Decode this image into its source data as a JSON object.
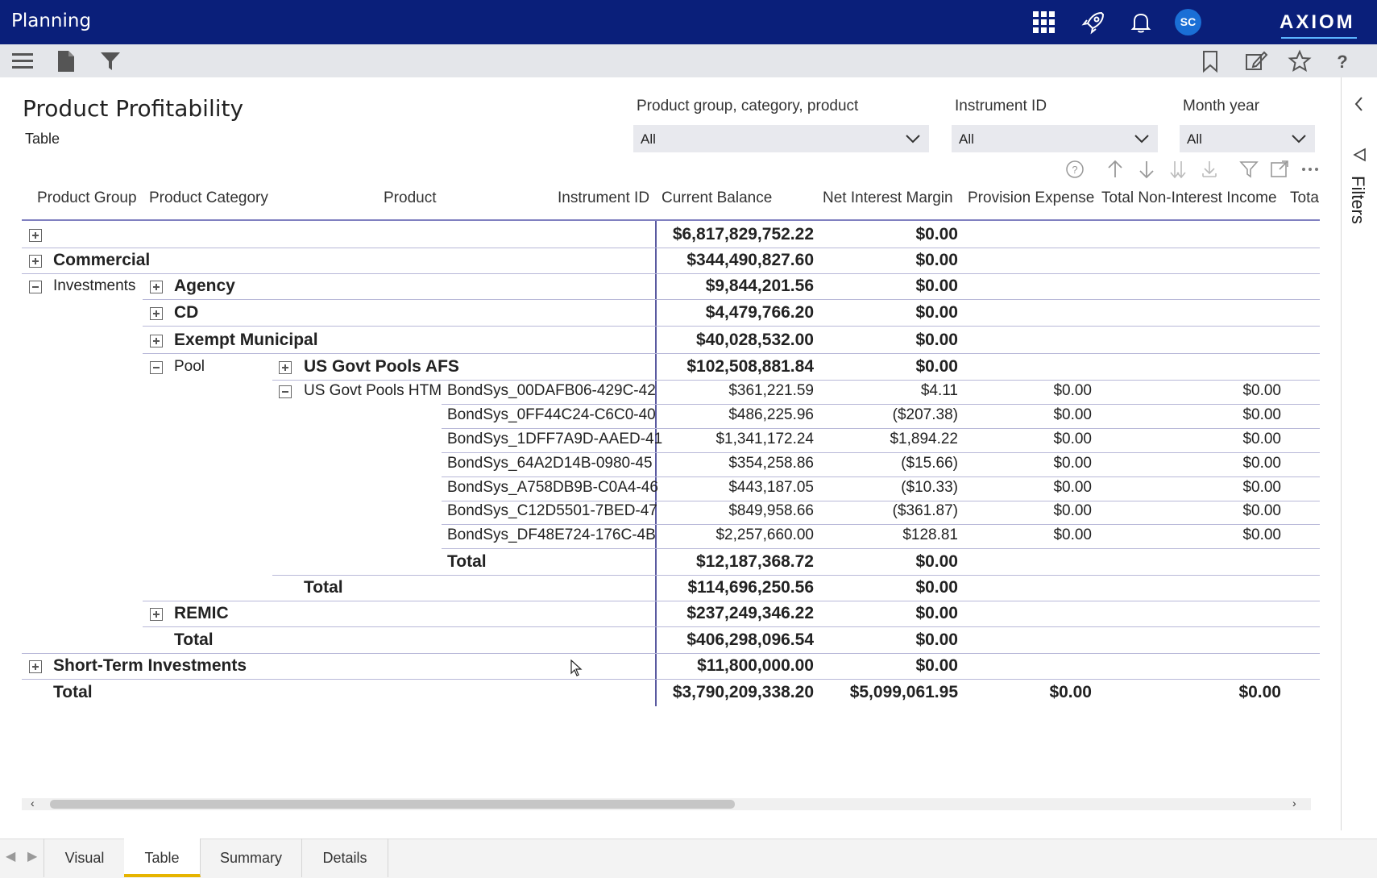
{
  "app": {
    "title": "Planning",
    "brand": "AXIOM",
    "avatar_initials": "SC"
  },
  "topbar_icons": [
    "apps-grid-icon",
    "rocket-icon",
    "bell-icon"
  ],
  "toolbar": {
    "left_icons": [
      "menu-icon",
      "document-icon",
      "filter-icon"
    ],
    "right_icons": [
      "bookmark-icon",
      "edit-icon",
      "star-icon",
      "help-icon"
    ]
  },
  "page": {
    "title": "Product Profitability",
    "subtitle": "Table"
  },
  "slicers": [
    {
      "label": "Product group, category, product",
      "value": "All"
    },
    {
      "label": "Instrument ID",
      "value": "All"
    },
    {
      "label": "Month year",
      "value": "All"
    }
  ],
  "right_panel": {
    "label": "Filters"
  },
  "table": {
    "headers": [
      "Product Group",
      "Product Category",
      "Product",
      "Instrument ID",
      "Current Balance",
      "Net Interest Margin",
      "Provision Expense",
      "Total Non-Interest Income",
      "Tota"
    ],
    "rows": [
      {
        "group": "",
        "category": "",
        "product": "",
        "instrument": "",
        "balance": "$6,817,829,752.22",
        "nim": "$0.00",
        "prov": "",
        "nii": ""
      },
      {
        "group": "Commercial",
        "balance": "$344,490,827.60",
        "nim": "$0.00"
      },
      {
        "group": "Investments",
        "category": "Agency",
        "balance": "$9,844,201.56",
        "nim": "$0.00"
      },
      {
        "category": "CD",
        "balance": "$4,479,766.20",
        "nim": "$0.00"
      },
      {
        "category": "Exempt Municipal",
        "balance": "$40,028,532.00",
        "nim": "$0.00"
      },
      {
        "category": "Pool",
        "product": "US Govt Pools AFS",
        "balance": "$102,508,881.84",
        "nim": "$0.00"
      },
      {
        "product": "US Govt Pools HTM",
        "instrument": "BondSys_00DAFB06-429C-42",
        "balance": "$361,221.59",
        "nim": "$4.11",
        "prov": "$0.00",
        "nii": "$0.00"
      },
      {
        "instrument": "BondSys_0FF44C24-C6C0-40",
        "balance": "$486,225.96",
        "nim": "($207.38)",
        "prov": "$0.00",
        "nii": "$0.00"
      },
      {
        "instrument": "BondSys_1DFF7A9D-AAED-41",
        "balance": "$1,341,172.24",
        "nim": "$1,894.22",
        "prov": "$0.00",
        "nii": "$0.00"
      },
      {
        "instrument": "BondSys_64A2D14B-0980-45",
        "balance": "$354,258.86",
        "nim": "($15.66)",
        "prov": "$0.00",
        "nii": "$0.00"
      },
      {
        "instrument": "BondSys_A758DB9B-C0A4-46",
        "balance": "$443,187.05",
        "nim": "($10.33)",
        "prov": "$0.00",
        "nii": "$0.00"
      },
      {
        "instrument": "BondSys_C12D5501-7BED-47",
        "balance": "$849,958.66",
        "nim": "($361.87)",
        "prov": "$0.00",
        "nii": "$0.00"
      },
      {
        "instrument": "BondSys_DF48E724-176C-4B",
        "balance": "$2,257,660.00",
        "nim": "$128.81",
        "prov": "$0.00",
        "nii": "$0.00"
      },
      {
        "instrument": "Total",
        "balance": "$12,187,368.72",
        "nim": "$0.00"
      },
      {
        "product": "Total",
        "balance": "$114,696,250.56",
        "nim": "$0.00"
      },
      {
        "category": "REMIC",
        "balance": "$237,249,346.22",
        "nim": "$0.00"
      },
      {
        "category": "Total",
        "balance": "$406,298,096.54",
        "nim": "$0.00"
      },
      {
        "group": "Short-Term Investments",
        "balance": "$11,800,000.00",
        "nim": "$0.00"
      },
      {
        "group": "Total",
        "balance": "$3,790,209,338.20",
        "nim": "$5,099,061.95",
        "prov": "$0.00",
        "nii": "$0.00"
      }
    ]
  },
  "tabs": [
    "Visual",
    "Table",
    "Summary",
    "Details"
  ],
  "active_tab": "Table"
}
